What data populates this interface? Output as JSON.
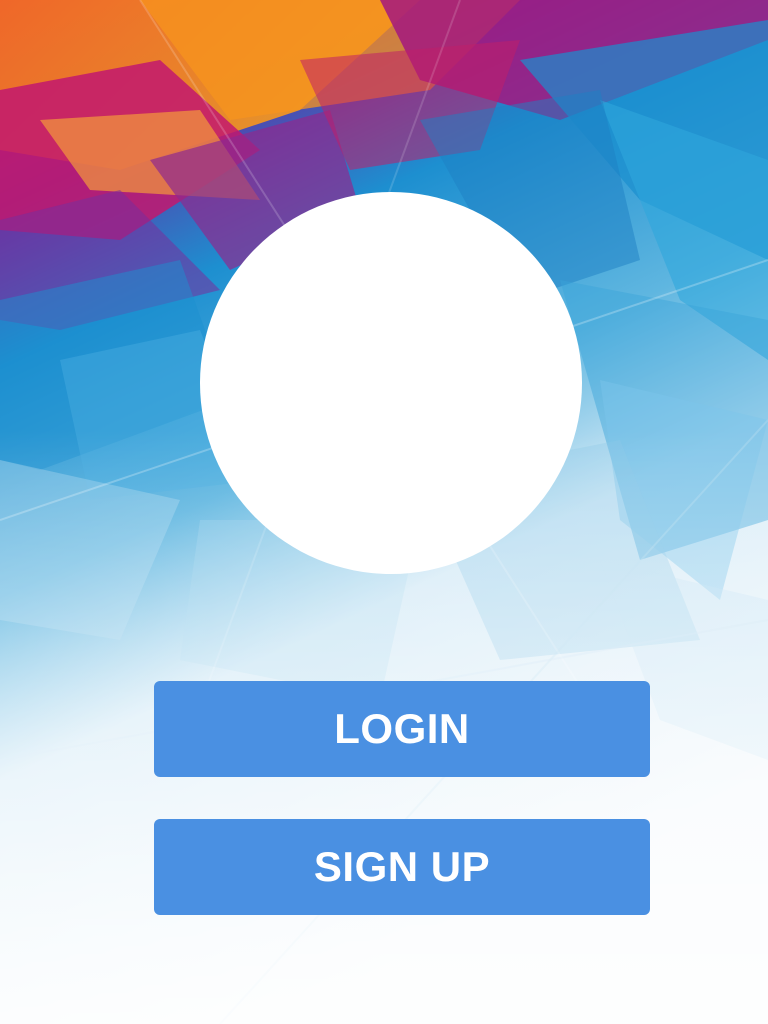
{
  "background": {
    "description_icon": "abstract-polygon-background",
    "colors": [
      "#f7941d",
      "#b0157a",
      "#1e9bd7",
      "#eaf4fb"
    ]
  },
  "logo": {
    "icon": "logo-placeholder-circle",
    "color": "#ffffff"
  },
  "actions": {
    "login_label": "LOGIN",
    "signup_label": "SIGN UP",
    "button_color": "#4a90e2",
    "button_text_color": "#ffffff"
  }
}
